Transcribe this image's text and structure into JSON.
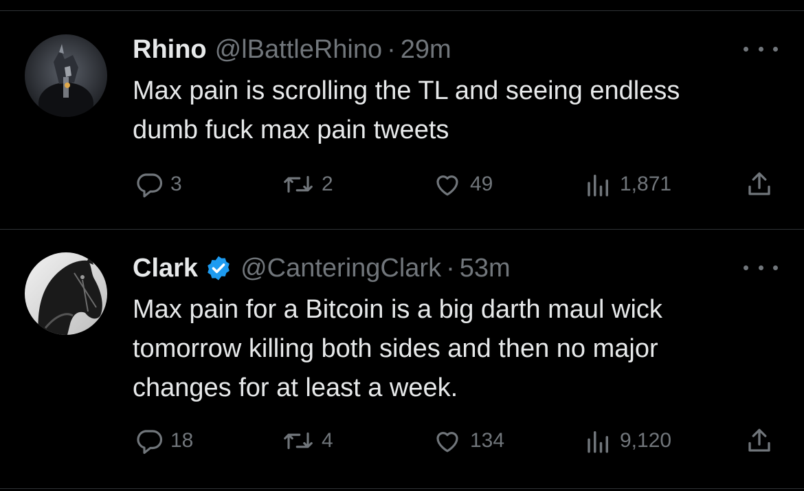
{
  "colors": {
    "background": "#000000",
    "primary_text": "#e7e9ea",
    "secondary_text": "#71767b",
    "divider": "#2f3336",
    "verified_badge": "#1d9bf0"
  },
  "tweets": [
    {
      "name": "Rhino",
      "handle": "@lBattleRhino",
      "separator": "·",
      "time": "29m",
      "verified": false,
      "text": "Max pain is scrolling the TL and seeing endless\ndumb fuck max pain tweets",
      "replies": "3",
      "retweets": "2",
      "likes": "49",
      "views": "1,871",
      "icons": {
        "reply": "reply-icon",
        "retweet": "retweet-icon",
        "like": "heart-icon",
        "views": "analytics-icon",
        "share": "share-icon",
        "more": "more-icon"
      }
    },
    {
      "name": "Clark",
      "handle": "@CanteringClark",
      "separator": "·",
      "time": "53m",
      "verified": true,
      "text": "Max pain for a Bitcoin is a big darth maul wick\ntomorrow killing both sides and then no major\nchanges for at least a week.",
      "replies": "18",
      "retweets": "4",
      "likes": "134",
      "views": "9,120",
      "icons": {
        "reply": "reply-icon",
        "retweet": "retweet-icon",
        "like": "heart-icon",
        "views": "analytics-icon",
        "share": "share-icon",
        "more": "more-icon",
        "verified": "verified-badge-icon"
      }
    }
  ]
}
